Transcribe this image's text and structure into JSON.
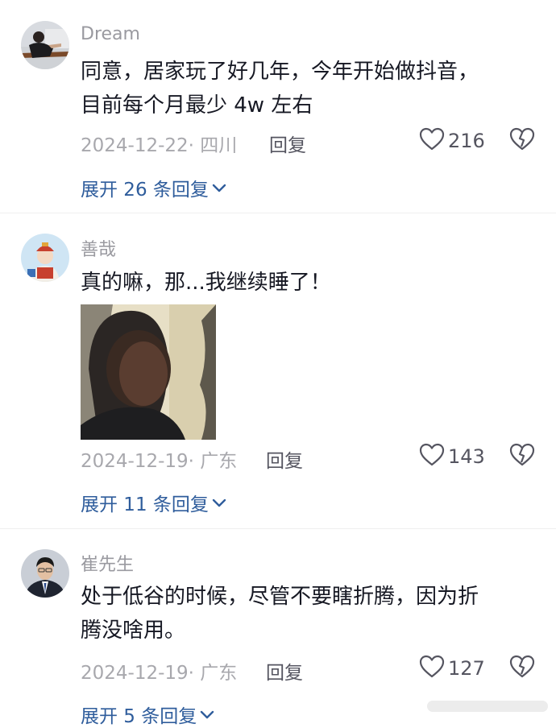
{
  "comments": [
    {
      "username": "Dream",
      "text": "同意，居家玩了好几年，今年开始做抖音，\n目前每个月最少 4w 左右",
      "date_location": "2024-12-22· 四川",
      "reply_label": "回复",
      "likes": "216",
      "expand_label": "展开 26 条回复"
    },
    {
      "username": "善哉",
      "text": "真的嘛，那...我继续睡了！",
      "date_location": "2024-12-19· 广东",
      "reply_label": "回复",
      "likes": "143",
      "expand_label": "展开 11 条回复"
    },
    {
      "username": "崔先生",
      "text": "处于低谷的时候，尽管不要瞎折腾，因为折\n腾没啥用。",
      "date_location": "2024-12-19· 广东",
      "reply_label": "回复",
      "likes": "127",
      "expand_label": "展开 5 条回复"
    }
  ],
  "icons": {
    "like": "heart-outline-icon",
    "dislike": "broken-heart-icon",
    "expand": "chevron-down-icon"
  },
  "colors": {
    "link": "#2f5d9c",
    "meta": "#a8a8ad",
    "text": "#161823"
  }
}
